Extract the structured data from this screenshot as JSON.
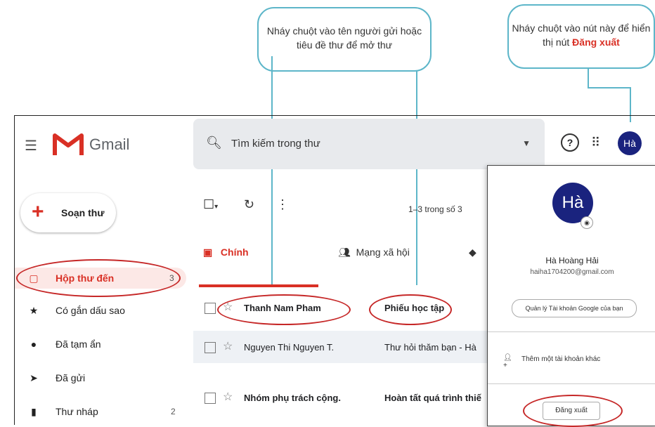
{
  "callouts": {
    "open_mail": "Nháy chuột vào tên người gửi hoặc tiêu đề thư để mở thư",
    "signout_prefix": "Nháy chuột vào nút này để hiển thị nút ",
    "signout_highlight": "Đăng xuất"
  },
  "header": {
    "app_name": "Gmail",
    "search_placeholder": "Tìm kiếm trong thư",
    "help_glyph": "?",
    "apps_glyph": "⠿",
    "avatar_text": "Hà"
  },
  "sidebar": {
    "compose_label": "Soạn thư",
    "items": [
      {
        "label": "Hộp thư đến",
        "icon": "inbox-icon",
        "count": "3"
      },
      {
        "label": "Có gắn dấu sao",
        "icon": "star-icon",
        "count": ""
      },
      {
        "label": "Đã tạm ẩn",
        "icon": "clock-icon",
        "count": ""
      },
      {
        "label": "Đã gửi",
        "icon": "send-icon",
        "count": ""
      },
      {
        "label": "Thư nháp",
        "icon": "draft-icon",
        "count": "2"
      }
    ]
  },
  "toolbar": {
    "range_text": "1–3 trong số 3"
  },
  "tabs": [
    {
      "label": "Chính",
      "icon": "inbox-icon"
    },
    {
      "label": "Mạng xã hội",
      "icon": "people-icon"
    },
    {
      "label": "",
      "icon": "tag-icon"
    }
  ],
  "emails": [
    {
      "sender": "Thanh Nam Pham",
      "subject": "Phiếu học tập",
      "unread": true
    },
    {
      "sender": "Nguyen Thi Nguyen T.",
      "subject": "Thư hỏi thăm bạn - Hà",
      "unread": false
    },
    {
      "sender": "Nhóm phụ trách cộng.",
      "subject": "Hoàn tất quá trình thiế",
      "unread": true
    }
  ],
  "account_panel": {
    "avatar_text": "Hà",
    "name": "Hà Hoàng Hải",
    "email": "haiha1704200@gmail.com",
    "manage_label": "Quản lý Tài khoản Google của bạn",
    "add_account_label": "Thêm một tài khoản khác",
    "signout_label": "Đăng xuất"
  },
  "colors": {
    "accent": "#d93025",
    "callout_border": "#5db6c9",
    "avatar_bg": "#1a237e"
  }
}
